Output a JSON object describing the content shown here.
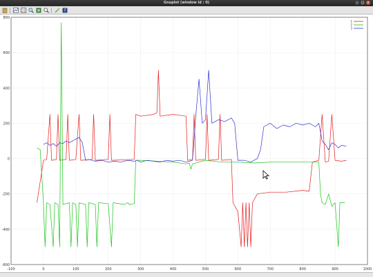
{
  "window": {
    "title": "Gnuplot (window id : 0)"
  },
  "toolbar": {
    "icons": [
      "clipboard-icon",
      "replot-icon",
      "grid-icon",
      "zoom-previous-icon",
      "zoom-next-icon",
      "autoscale-icon",
      "ruler-icon",
      "help-icon"
    ]
  },
  "status": {
    "coordinates": ""
  },
  "colors": {
    "series1": "#e41a1c",
    "series2": "#18c318",
    "series3": "#3030d0",
    "grid": "#c8c8c8"
  },
  "chart_data": {
    "type": "line",
    "title": "",
    "xlabel": "",
    "ylabel": "",
    "xlim": [
      -100,
      1000
    ],
    "ylim": [
      -600,
      800
    ],
    "xticks": [
      "-100",
      "0",
      "100",
      "200",
      "300",
      "400",
      "500",
      "600",
      "700",
      "800",
      "900",
      "1000"
    ],
    "yticks": [
      "800",
      "600",
      "400",
      "200",
      "0",
      "-200",
      "-400",
      "-600"
    ],
    "grid": true,
    "legend_position": "top-right",
    "series": [
      {
        "name": "1",
        "color": "#e41a1c",
        "points": [
          [
            -20,
            -250
          ],
          [
            0,
            -10
          ],
          [
            10,
            -5
          ],
          [
            20,
            250
          ],
          [
            25,
            -10
          ],
          [
            40,
            -5
          ],
          [
            45,
            250
          ],
          [
            50,
            -10
          ],
          [
            70,
            -5
          ],
          [
            75,
            250
          ],
          [
            80,
            -10
          ],
          [
            100,
            -5
          ],
          [
            110,
            250
          ],
          [
            115,
            -10
          ],
          [
            150,
            -5
          ],
          [
            155,
            250
          ],
          [
            160,
            -10
          ],
          [
            200,
            -5
          ],
          [
            205,
            250
          ],
          [
            210,
            -10
          ],
          [
            280,
            -5
          ],
          [
            285,
            250
          ],
          [
            300,
            240
          ],
          [
            340,
            250
          ],
          [
            350,
            260
          ],
          [
            355,
            500
          ],
          [
            360,
            240
          ],
          [
            400,
            250
          ],
          [
            440,
            240
          ],
          [
            445,
            -10
          ],
          [
            460,
            -5
          ],
          [
            465,
            250
          ],
          [
            470,
            -10
          ],
          [
            500,
            -5
          ],
          [
            505,
            250
          ],
          [
            510,
            -10
          ],
          [
            540,
            -5
          ],
          [
            545,
            250
          ],
          [
            550,
            -10
          ],
          [
            580,
            -5
          ],
          [
            585,
            -250
          ],
          [
            600,
            -300
          ],
          [
            610,
            -500
          ],
          [
            615,
            -250
          ],
          [
            620,
            -500
          ],
          [
            625,
            -250
          ],
          [
            630,
            -500
          ],
          [
            635,
            -250
          ],
          [
            640,
            -500
          ],
          [
            645,
            -250
          ],
          [
            660,
            -200
          ],
          [
            700,
            -190
          ],
          [
            750,
            -190
          ],
          [
            800,
            -180
          ],
          [
            820,
            -185
          ],
          [
            830,
            -20
          ],
          [
            850,
            -10
          ],
          [
            860,
            250
          ],
          [
            870,
            -20
          ],
          [
            880,
            -15
          ],
          [
            890,
            250
          ],
          [
            900,
            -10
          ],
          [
            920,
            -15
          ],
          [
            935,
            -10
          ]
        ]
      },
      {
        "name": "2",
        "color": "#18c318",
        "points": [
          [
            -20,
            60
          ],
          [
            -10,
            50
          ],
          [
            0,
            -250
          ],
          [
            5,
            -500
          ],
          [
            10,
            -250
          ],
          [
            20,
            -260
          ],
          [
            30,
            -500
          ],
          [
            35,
            -250
          ],
          [
            45,
            -260
          ],
          [
            50,
            -500
          ],
          [
            55,
            770
          ],
          [
            60,
            -260
          ],
          [
            80,
            -250
          ],
          [
            85,
            -500
          ],
          [
            90,
            -250
          ],
          [
            100,
            -260
          ],
          [
            105,
            -500
          ],
          [
            110,
            -250
          ],
          [
            130,
            -260
          ],
          [
            135,
            -500
          ],
          [
            140,
            -250
          ],
          [
            160,
            -260
          ],
          [
            165,
            -500
          ],
          [
            170,
            -250
          ],
          [
            200,
            -255
          ],
          [
            210,
            -500
          ],
          [
            215,
            -250
          ],
          [
            250,
            -260
          ],
          [
            260,
            -250
          ],
          [
            265,
            -260
          ],
          [
            280,
            -255
          ],
          [
            285,
            -10
          ],
          [
            300,
            -10
          ],
          [
            350,
            -15
          ],
          [
            400,
            -20
          ],
          [
            440,
            -30
          ],
          [
            450,
            -25
          ],
          [
            455,
            -60
          ],
          [
            460,
            -30
          ],
          [
            500,
            -10
          ],
          [
            550,
            -20
          ],
          [
            600,
            -20
          ],
          [
            650,
            -25
          ],
          [
            700,
            -20
          ],
          [
            750,
            -20
          ],
          [
            800,
            -20
          ],
          [
            850,
            -20
          ],
          [
            855,
            -200
          ],
          [
            860,
            -250
          ],
          [
            870,
            -260
          ],
          [
            880,
            -200
          ],
          [
            890,
            -270
          ],
          [
            900,
            -250
          ],
          [
            910,
            -500
          ],
          [
            915,
            -250
          ],
          [
            930,
            -250
          ]
        ]
      },
      {
        "name": "3",
        "color": "#3030d0",
        "points": [
          [
            0,
            80
          ],
          [
            10,
            90
          ],
          [
            20,
            75
          ],
          [
            30,
            85
          ],
          [
            40,
            70
          ],
          [
            50,
            90
          ],
          [
            60,
            85
          ],
          [
            70,
            100
          ],
          [
            80,
            90
          ],
          [
            100,
            110
          ],
          [
            110,
            120
          ],
          [
            120,
            90
          ],
          [
            130,
            -10
          ],
          [
            140,
            -5
          ],
          [
            160,
            -15
          ],
          [
            180,
            -10
          ],
          [
            200,
            -20
          ],
          [
            220,
            -15
          ],
          [
            240,
            -20
          ],
          [
            260,
            -10
          ],
          [
            280,
            -15
          ],
          [
            290,
            -10
          ],
          [
            300,
            -20
          ],
          [
            320,
            -10
          ],
          [
            340,
            -15
          ],
          [
            360,
            -20
          ],
          [
            380,
            -10
          ],
          [
            400,
            -15
          ],
          [
            420,
            -10
          ],
          [
            440,
            -20
          ],
          [
            460,
            -10
          ],
          [
            470,
            240
          ],
          [
            480,
            450
          ],
          [
            490,
            200
          ],
          [
            500,
            220
          ],
          [
            510,
            500
          ],
          [
            520,
            200
          ],
          [
            540,
            220
          ],
          [
            560,
            210
          ],
          [
            580,
            230
          ],
          [
            590,
            200
          ],
          [
            600,
            -10
          ],
          [
            620,
            -10
          ],
          [
            640,
            -20
          ],
          [
            650,
            -10
          ],
          [
            660,
            0
          ],
          [
            670,
            50
          ],
          [
            680,
            180
          ],
          [
            700,
            200
          ],
          [
            720,
            170
          ],
          [
            740,
            190
          ],
          [
            760,
            180
          ],
          [
            780,
            200
          ],
          [
            800,
            190
          ],
          [
            820,
            200
          ],
          [
            840,
            180
          ],
          [
            850,
            200
          ],
          [
            860,
            100
          ],
          [
            870,
            80
          ],
          [
            880,
            50
          ],
          [
            890,
            90
          ],
          [
            900,
            80
          ],
          [
            910,
            60
          ],
          [
            920,
            75
          ],
          [
            935,
            70
          ]
        ]
      }
    ]
  }
}
